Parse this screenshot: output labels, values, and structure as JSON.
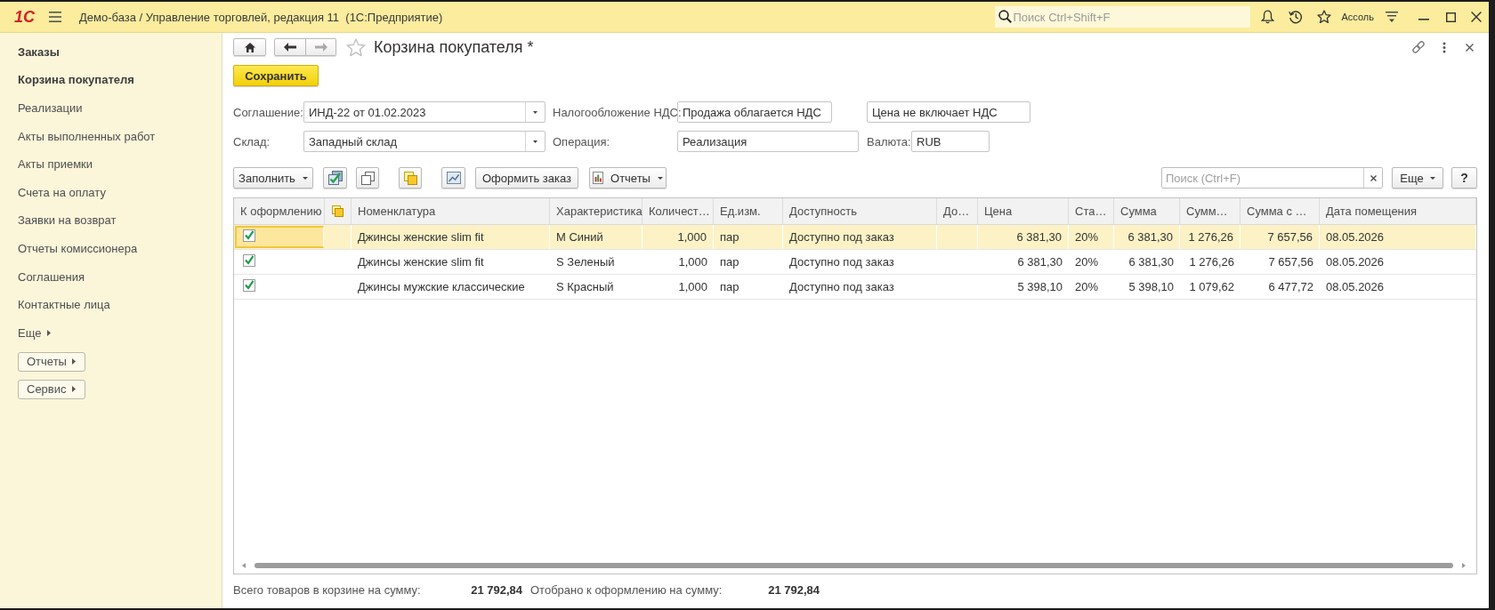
{
  "top_bar": {
    "logo": "1С",
    "title": "Демо-база / Управление торговлей, редакция 11  (1С:Предприятие)",
    "search_placeholder": "Поиск Ctrl+Shift+F",
    "user": "Ассоль"
  },
  "sidebar": {
    "items": [
      {
        "label": "Заказы",
        "important": true
      },
      {
        "label": "Корзина покупателя",
        "important": true
      },
      {
        "label": "Реализации",
        "important": false
      },
      {
        "label": "Акты выполненных работ",
        "important": false
      },
      {
        "label": "Акты приемки",
        "important": false
      },
      {
        "label": "Счета на оплату",
        "important": false
      },
      {
        "label": "Заявки на возврат",
        "important": false
      },
      {
        "label": "Отчеты комиссионера",
        "important": false
      },
      {
        "label": "Соглашения",
        "important": false
      },
      {
        "label": "Контактные лица",
        "important": false
      }
    ],
    "more": "Еще",
    "buttons": [
      "Отчеты",
      "Сервис"
    ]
  },
  "form": {
    "title": "Корзина покупателя *",
    "save_button": "Сохранить",
    "fields": [
      [
        {
          "label": "Соглашение:",
          "value": "ИНД-22 от 01.02.2023",
          "kind": "dropdown"
        },
        {
          "label": "Налогообложение НДС:",
          "value": "Продажа облагается НДС",
          "kind": "text"
        },
        {
          "value": "Цена не включает НДС",
          "kind": "text"
        }
      ],
      [
        {
          "label": "Склад:",
          "value": "Западный склад",
          "kind": "dropdown"
        },
        {
          "label": "Операция:",
          "value": "Реализация",
          "kind": "text"
        },
        {
          "label": "Валюта:",
          "value": "RUB",
          "kind": "text"
        }
      ]
    ],
    "toolbar": {
      "fill_button": "Заполнить",
      "order_button": "Оформить заказ",
      "reports_button": "Отчеты",
      "search_placeholder": "Поиск (Ctrl+F)",
      "more_button": "Еще",
      "help_button": "?"
    },
    "table": {
      "columns": [
        {
          "label": "К оформлению",
          "kind": "check"
        },
        {
          "kind": "icon"
        },
        {
          "label": "Номенклатура",
          "kind": "text"
        },
        {
          "label": "Характеристика",
          "kind": "text"
        },
        {
          "label": "Количест…",
          "kind": "number"
        },
        {
          "label": "Ед.изм.",
          "kind": "text"
        },
        {
          "label": "Доступность",
          "kind": "text"
        },
        {
          "label": "До…",
          "kind": "text"
        },
        {
          "label": "Цена",
          "kind": "number"
        },
        {
          "label": "Ста…",
          "kind": "text"
        },
        {
          "label": "Сумма",
          "kind": "number"
        },
        {
          "label": "Сумм…",
          "kind": "number"
        },
        {
          "label": "Сумма с …",
          "kind": "number"
        },
        {
          "label": "Дата помещения",
          "kind": "text"
        }
      ],
      "rows": [
        {
          "selected": true,
          "checked": true,
          "cells": [
            "",
            "",
            "Джинсы женские slim fit",
            "M Синий",
            "1,000",
            "пар",
            "Доступно под заказ",
            "",
            "6 381,30",
            "20%",
            "6 381,30",
            "1 276,26",
            "7 657,56",
            "08.05.2026"
          ]
        },
        {
          "selected": false,
          "checked": true,
          "cells": [
            "",
            "",
            "Джинсы женские slim fit",
            "S Зеленый",
            "1,000",
            "пар",
            "Доступно под заказ",
            "",
            "6 381,30",
            "20%",
            "6 381,30",
            "1 276,26",
            "7 657,56",
            "08.05.2026"
          ]
        },
        {
          "selected": false,
          "checked": true,
          "cells": [
            "",
            "",
            "Джинсы мужские классические",
            "S Красный",
            "1,000",
            "пар",
            "Доступно под заказ",
            "",
            "5 398,10",
            "20%",
            "5 398,10",
            "1 079,62",
            "6 477,72",
            "08.05.2026"
          ]
        }
      ]
    },
    "footer": [
      {
        "label": "Всего товаров в корзине на сумму:",
        "value": "21 792,84"
      },
      {
        "label": "Отобрано к оформлению на сумму:",
        "value": "21 792,84"
      }
    ]
  }
}
